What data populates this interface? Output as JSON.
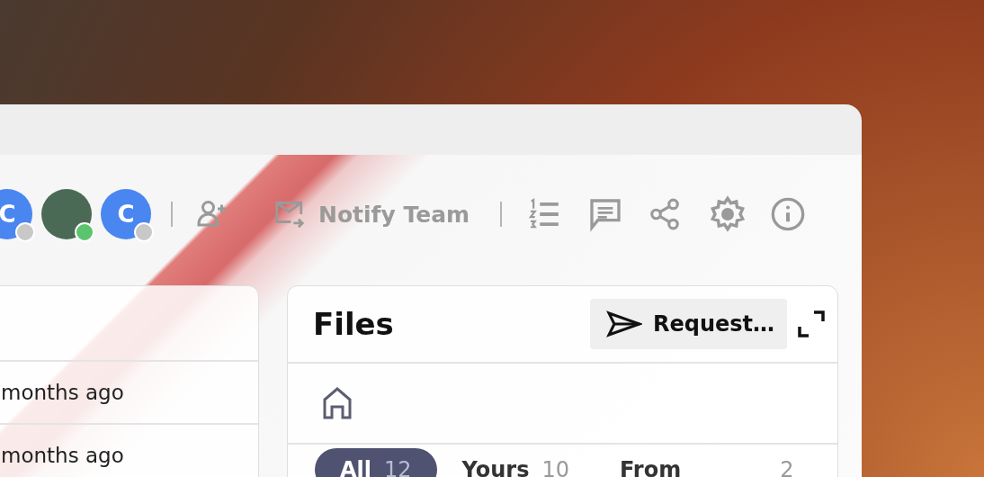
{
  "toolbar": {
    "avatars": [
      {
        "kind": "initial",
        "initial": "C",
        "color": "#c8c8c8"
      },
      {
        "kind": "photo",
        "color": "#5cc46e"
      },
      {
        "kind": "initial",
        "initial": "C",
        "color": "#c8c8c8"
      }
    ],
    "notify_button": "Notify Team"
  },
  "activity_panel": {
    "rows": [
      {
        "time": "months ago"
      },
      {
        "time": "months ago"
      }
    ]
  },
  "files_panel": {
    "title": "Files",
    "request_button": "Request…",
    "tabs": [
      {
        "label": "All",
        "count": "12",
        "selected": true
      },
      {
        "label": "Yours",
        "count": "10",
        "selected": false
      },
      {
        "label": "From",
        "count": "2",
        "selected": false
      }
    ]
  }
}
